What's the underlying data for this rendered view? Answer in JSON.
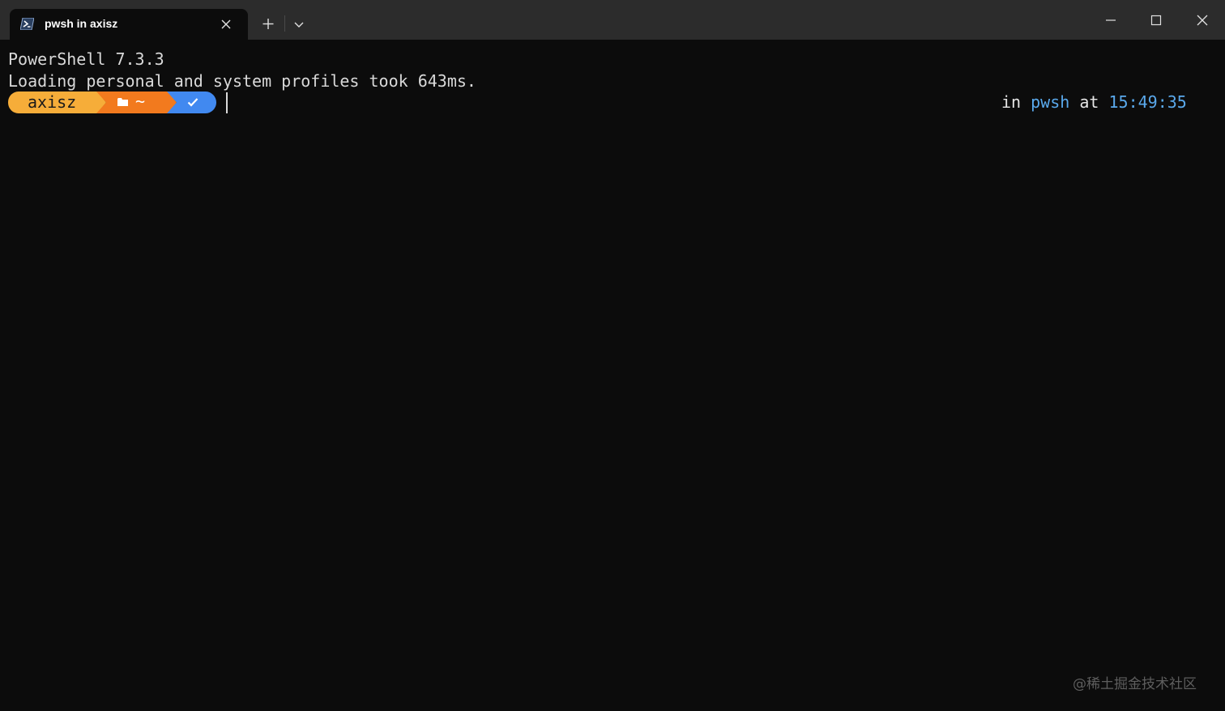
{
  "tab": {
    "title": "pwsh in axisz",
    "icon": "powershell-icon"
  },
  "titlebar": {
    "new_tab_icon": "plus-icon",
    "dropdown_icon": "chevron-down-icon",
    "minimize_icon": "minimize-icon",
    "maximize_icon": "maximize-icon",
    "close_icon": "close-icon"
  },
  "terminal": {
    "lines": [
      "PowerShell 7.3.3",
      "Loading personal and system profiles took 643ms."
    ],
    "prompt": {
      "user": "axisz",
      "path": "~",
      "path_icon": "folder-icon",
      "status_icon": "check-icon",
      "colors": {
        "user_segment": "#f6ad39",
        "path_segment": "#f27a1e",
        "status_segment": "#4189f0"
      }
    },
    "right_prompt": {
      "in_label": "in",
      "shell": "pwsh",
      "at_label": "at",
      "time": "15:49:35",
      "accent_color": "#5aa9ec"
    }
  },
  "watermark": "@稀土掘金技术社区"
}
